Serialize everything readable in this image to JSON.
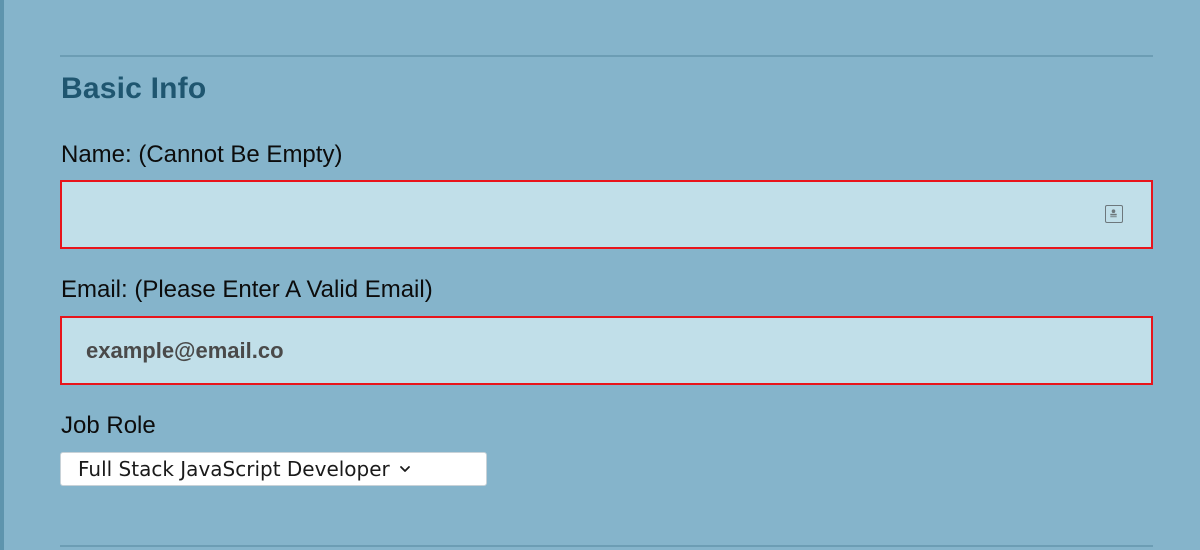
{
  "section": {
    "title": "Basic Info"
  },
  "fields": {
    "name": {
      "label": "Name: (Cannot Be Empty)",
      "value": "",
      "icon": "contact-card-icon"
    },
    "email": {
      "label": "Email: (Please Enter A Valid Email)",
      "value": "example@email.co"
    },
    "job_role": {
      "label": "Job Role",
      "selected": "Full Stack JavaScript Developer",
      "icon": "chevron-down-icon"
    }
  },
  "colors": {
    "page_background": "#85b4cb",
    "title": "#1f5670",
    "input_background": "#c1dfe9",
    "error_border": "#e8141b"
  }
}
